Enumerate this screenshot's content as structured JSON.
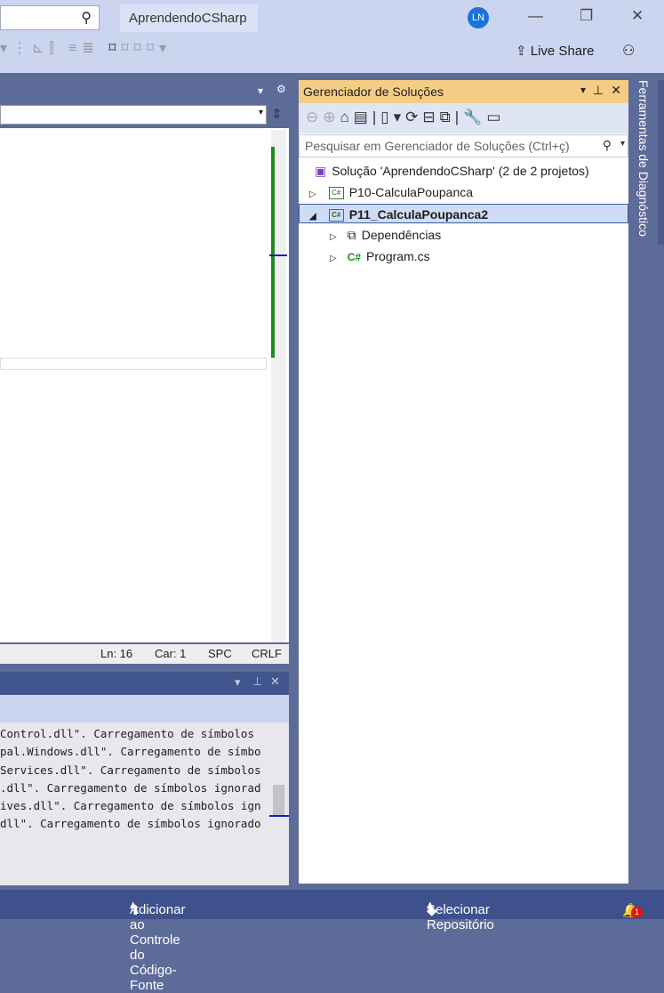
{
  "title": {
    "project": "AprendendoCSharp",
    "avatar": "LN",
    "live_share": "Live Share"
  },
  "editor": {
    "status": {
      "line": "Ln: 16",
      "col": "Car: 1",
      "spaces": "SPC",
      "eol": "CRLF"
    }
  },
  "output": {
    "lines": [
      "Control.dll\". Carregamento de símbolos",
      "pal.Windows.dll\". Carregamento de símbo",
      "Services.dll\". Carregamento de símbolos",
      ".dll\". Carregamento de símbolos ignorad",
      "ives.dll\". Carregamento de símbolos ign",
      "dll\". Carregamento de símbolos ignorado"
    ]
  },
  "solution_explorer": {
    "title": "Gerenciador de Soluções",
    "search_placeholder": "Pesquisar em Gerenciador de Soluções (Ctrl+ç)",
    "tree": {
      "solution": "Solução 'AprendendoCSharp' (2 de 2 projetos)",
      "p10": "P10-CalculaPoupanca",
      "p11": "P11_CalculaPoupanca2",
      "deps": "Dependências",
      "program": "Program.cs"
    }
  },
  "side_tab": "Ferramentas de Diagnóstico",
  "statusbar": {
    "source_control": "Adicionar ao Controle do Código-Fonte",
    "repo": "Selecionar Repositório",
    "notifications": "1"
  },
  "colors": {
    "accent": "#f5cc84",
    "chrome": "#5d6b99",
    "statusbar": "#3e518c"
  }
}
